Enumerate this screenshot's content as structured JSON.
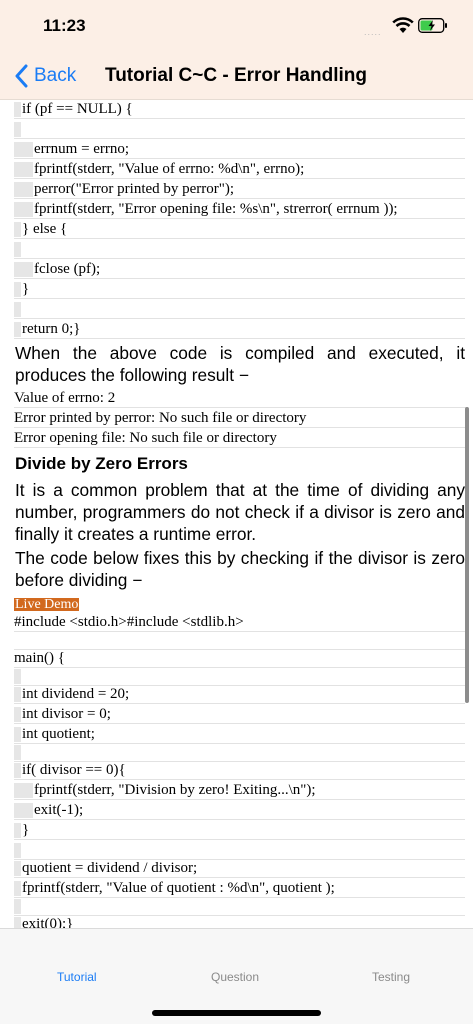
{
  "status": {
    "time": "11:23",
    "signal": "....."
  },
  "nav": {
    "back_label": "Back",
    "title": "Tutorial C~C - Error Handling"
  },
  "code1": [
    "if (pf == NULL) {",
    "",
    "errnum = errno;",
    "fprintf(stderr, \"Value of errno: %d\\n\", errno);",
    "perror(\"Error printed by perror\");",
    "fprintf(stderr, \"Error opening file: %s\\n\", strerror( errnum ));",
    "} else {",
    "",
    "fclose (pf);",
    "}",
    "",
    "return 0;}"
  ],
  "para1": "When the above code is compiled and executed, it produces the following result −",
  "output": [
    "Value of errno: 2",
    "Error printed by perror: No such file or directory",
    "Error opening file: No such file or directory"
  ],
  "heading": "Divide by Zero Errors",
  "para2": "It is a common problem that at the time of dividing any number, programmers do not check if a divisor is zero and finally it creates a runtime error.",
  "para3": "The code below fixes this by checking if the divisor is zero before dividing −",
  "live_demo": "Live Demo",
  "code2": [
    "#include <stdio.h>#include <stdlib.h>",
    "",
    "main() {",
    "",
    "int dividend = 20;",
    "int divisor = 0;",
    "int quotient;",
    "",
    "if( divisor == 0){",
    "fprintf(stderr, \"Division by zero! Exiting...\\n\");",
    "exit(-1);",
    "}",
    "",
    "quotient = dividend / divisor;",
    "fprintf(stderr, \"Value of quotient : %d\\n\", quotient );",
    "",
    "exit(0);}"
  ],
  "tabs": {
    "tutorial": "Tutorial",
    "question": "Question",
    "testing": "Testing"
  },
  "colors": {
    "accent": "#1a7cf5",
    "header_bg": "#fcefe6",
    "live_demo_bg": "#d2691e"
  }
}
